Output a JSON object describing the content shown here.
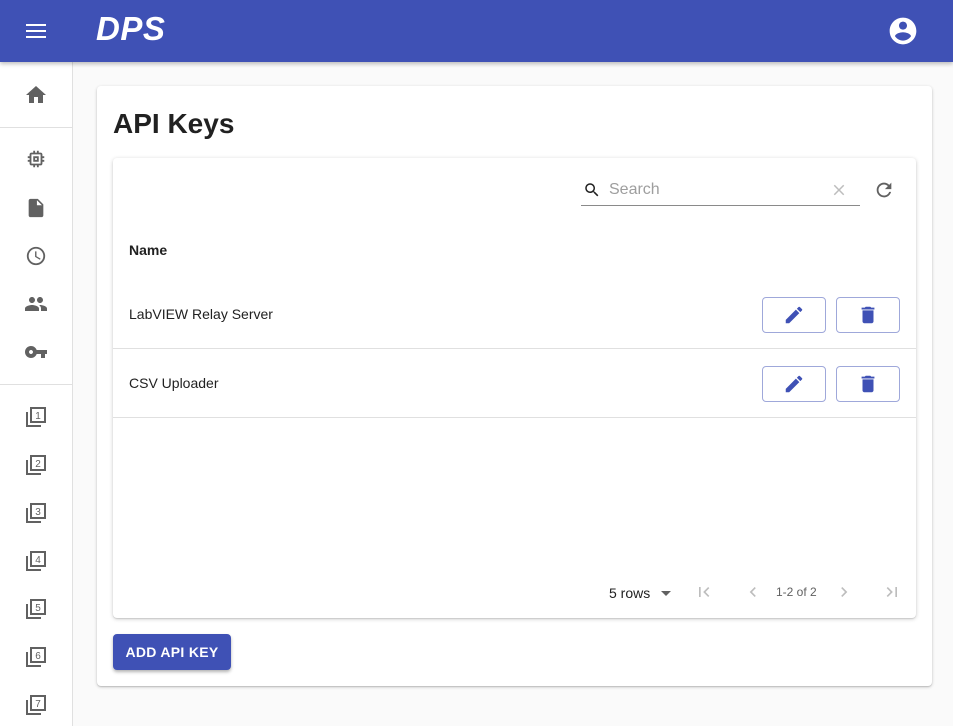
{
  "app": {
    "brand": "DPS"
  },
  "header": {
    "menu_icon": "menu-icon",
    "account_icon": "account-circle-icon"
  },
  "sidebar": {
    "items": [
      {
        "name": "home",
        "icon": "home-icon"
      },
      {
        "name": "devices",
        "icon": "chip-icon"
      },
      {
        "name": "documents",
        "icon": "document-icon"
      },
      {
        "name": "history",
        "icon": "clock-icon"
      },
      {
        "name": "users",
        "icon": "people-icon"
      },
      {
        "name": "api-keys",
        "icon": "key-icon"
      },
      {
        "name": "view-1",
        "icon": "filter-1-icon",
        "label": "1"
      },
      {
        "name": "view-2",
        "icon": "filter-2-icon",
        "label": "2"
      },
      {
        "name": "view-3",
        "icon": "filter-3-icon",
        "label": "3"
      },
      {
        "name": "view-4",
        "icon": "filter-4-icon",
        "label": "4"
      },
      {
        "name": "view-5",
        "icon": "filter-5-icon",
        "label": "5"
      },
      {
        "name": "view-6",
        "icon": "filter-6-icon",
        "label": "6"
      },
      {
        "name": "view-7",
        "icon": "filter-7-icon",
        "label": "7"
      }
    ]
  },
  "page": {
    "title": "API Keys"
  },
  "table": {
    "search": {
      "placeholder": "Search",
      "value": ""
    },
    "columns": [
      "Name"
    ],
    "rows": [
      {
        "name": "LabVIEW Relay Server"
      },
      {
        "name": "CSV Uploader"
      }
    ],
    "pagination": {
      "rows_per_page": "5 rows",
      "info": "1-2 of 2"
    }
  },
  "actions": {
    "add_label": "ADD API KEY"
  },
  "colors": {
    "primary": "#3f51b5",
    "icon_gray": "#616161",
    "outline": "#9fa8da"
  }
}
